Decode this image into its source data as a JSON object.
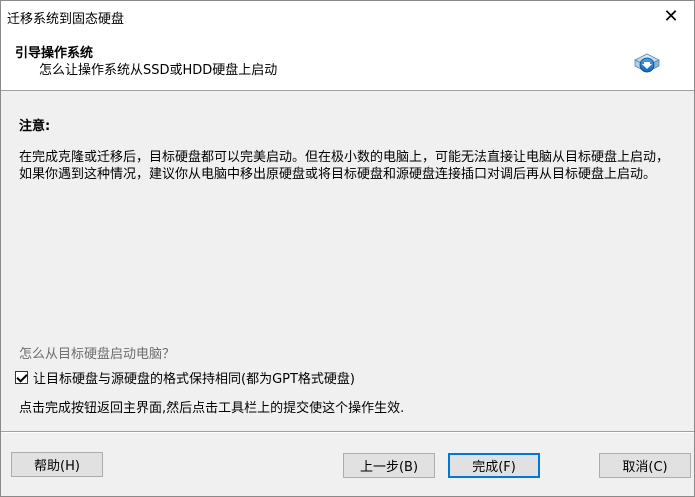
{
  "window": {
    "title": "迁移系统到固态硬盘",
    "close_glyph": "✕"
  },
  "header": {
    "title": "引导操作系统",
    "subtitle": "怎么让操作系统从SSD或HDD硬盘上启动",
    "icon": "disk-boot-icon"
  },
  "note": {
    "title": "注意:",
    "text": "在完成克隆或迁移后，目标硬盘都可以完美启动。但在极小数的电脑上，可能无法直接让电脑从目标硬盘上启动，如果你遇到这种情况，建议你从电脑中移出原硬盘或将目标硬盘和源硬盘连接插口对调后再从目标硬盘上启动。"
  },
  "question": "怎么从目标硬盘启动电脑？",
  "checkbox": {
    "label": "让目标硬盘与源硬盘的格式保持相同(都为GPT格式硬盘)",
    "checked": true
  },
  "info": "点击完成按钮返回主界面,然后点击工具栏上的提交使这个操作生效.",
  "buttons": {
    "help": "帮助(H)",
    "prev": "上一步(B)",
    "finish": "完成(F)",
    "cancel": "取消(C)"
  },
  "colors": {
    "default_button_border": "#0078d7",
    "question_text": "#6d6d6d"
  }
}
